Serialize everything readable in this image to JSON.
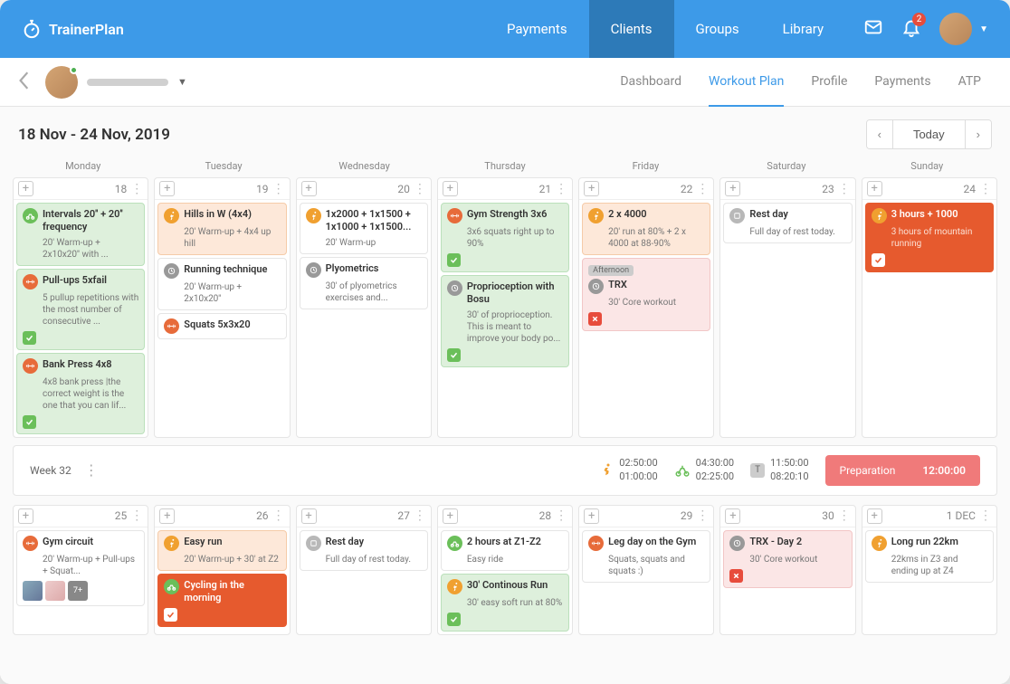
{
  "brand": "TrainerPlan",
  "topnav": [
    "Payments",
    "Clients",
    "Groups",
    "Library"
  ],
  "topnav_active": 1,
  "notif_count": "2",
  "subtabs": [
    "Dashboard",
    "Workout Plan",
    "Profile",
    "Payments",
    "ATP"
  ],
  "subtab_active": 1,
  "date_range": "18 Nov - 24 Nov, 2019",
  "today_label": "Today",
  "weekdays": [
    "Monday",
    "Tuesday",
    "Wednesday",
    "Thursday",
    "Friday",
    "Saturday",
    "Sunday"
  ],
  "week1": {
    "num": "Week 32",
    "days": [
      {
        "d": "18",
        "cards": [
          {
            "t": "Intervals 20'' + 20'' frequency",
            "s": "20' Warm-up + 2x10x20'' with ...",
            "i": "bike",
            "cls": "green",
            "chk": false
          },
          {
            "t": "Pull-ups 5xfail",
            "s": "5 pullup repetitions with the most number of consecutive ...",
            "i": "strength",
            "cls": "green",
            "chk": "green"
          },
          {
            "t": "Bank Press 4x8",
            "s": "4x8 bank press |the correct weight is the one that you can lif...",
            "i": "strength",
            "cls": "green",
            "chk": "green"
          }
        ]
      },
      {
        "d": "19",
        "cards": [
          {
            "t": "Hills in W (4x4)",
            "s": "20' Warm-up + 4x4 up hill",
            "i": "run",
            "cls": "orange-light"
          },
          {
            "t": "Running technique",
            "s": "20' Warm-up + 2x10x20''",
            "i": "gray",
            "cls": "white"
          },
          {
            "t": "Squats 5x3x20",
            "s": "",
            "i": "strength",
            "cls": "white"
          }
        ]
      },
      {
        "d": "20",
        "cards": [
          {
            "t": "1x2000 + 1x1500 + 1x1000 + 1x1500...",
            "s": "20' Warm-up",
            "i": "run",
            "cls": "white"
          },
          {
            "t": "Plyometrics",
            "s": "30' of plyometrics exercises and...",
            "i": "gray",
            "cls": "white"
          }
        ]
      },
      {
        "d": "21",
        "cards": [
          {
            "t": "Gym Strength 3x6",
            "s": "3x6 squats right up to 90%",
            "i": "strength",
            "cls": "green",
            "chk": "green"
          },
          {
            "t": "Proprioception with Bosu",
            "s": "30' of proprioception. This is meant to improve your body po...",
            "i": "gray",
            "cls": "green",
            "chk": "green"
          }
        ]
      },
      {
        "d": "22",
        "cards": [
          {
            "t": "2 x 4000",
            "s": "20' run at 80% + 2 x 4000 at 88-90%",
            "i": "run",
            "cls": "orange-light"
          },
          {
            "tag": "Afternoon",
            "t": "TRX",
            "s": "30' Core workout",
            "i": "gray",
            "cls": "pink",
            "chk": "red"
          }
        ]
      },
      {
        "d": "23",
        "cards": [
          {
            "t": "Rest day",
            "s": "Full day of rest today.",
            "i": "rest",
            "cls": "white"
          }
        ]
      },
      {
        "d": "24",
        "cards": [
          {
            "t": "3 hours + 1000",
            "s": "3 hours of mountain running",
            "i": "run",
            "cls": "orange",
            "chk": "white"
          }
        ]
      }
    ],
    "stats": {
      "run": {
        "a": "02:50:00",
        "b": "01:00:00"
      },
      "bike": {
        "a": "04:30:00",
        "b": "02:25:00"
      },
      "t": {
        "a": "11:50:00",
        "b": "08:20:10"
      }
    },
    "prep": {
      "label": "Preparation",
      "time": "12:00:00"
    }
  },
  "week2": {
    "days": [
      {
        "d": "25",
        "cards": [
          {
            "t": "Gym circuit",
            "s": "20' Warm-up + Pull-ups + Squat...",
            "i": "strength",
            "cls": "white",
            "thumbs": true
          }
        ]
      },
      {
        "d": "26",
        "cards": [
          {
            "t": "Easy run",
            "s": "20' Warm-up + 30' at Z2",
            "i": "run",
            "cls": "orange-light"
          },
          {
            "t": "Cycling in the morning",
            "s": "",
            "i": "bike",
            "cls": "orange",
            "chk": "white"
          }
        ]
      },
      {
        "d": "27",
        "cards": [
          {
            "t": "Rest day",
            "s": "Full day of rest today.",
            "i": "rest",
            "cls": "white"
          }
        ]
      },
      {
        "d": "28",
        "cards": [
          {
            "t": "2 hours at Z1-Z2",
            "s": "Easy ride",
            "i": "bike",
            "cls": "white"
          },
          {
            "t": "30' Continous Run",
            "s": "30' easy soft run at 80%",
            "i": "run",
            "cls": "green",
            "chk": "green"
          }
        ]
      },
      {
        "d": "29",
        "cards": [
          {
            "t": "Leg day on the Gym",
            "s": "Squats, squats and squats :)",
            "i": "strength",
            "cls": "white"
          }
        ]
      },
      {
        "d": "30",
        "cards": [
          {
            "t": "TRX - Day 2",
            "s": "30' Core workout",
            "i": "gray",
            "cls": "pink",
            "chk": "red"
          }
        ]
      },
      {
        "d": "1 DEC",
        "cards": [
          {
            "t": "Long run 22km",
            "s": "22kms in Z3 and ending up at Z4",
            "i": "run",
            "cls": "white"
          }
        ]
      }
    ]
  },
  "thumbs_more": "7+"
}
